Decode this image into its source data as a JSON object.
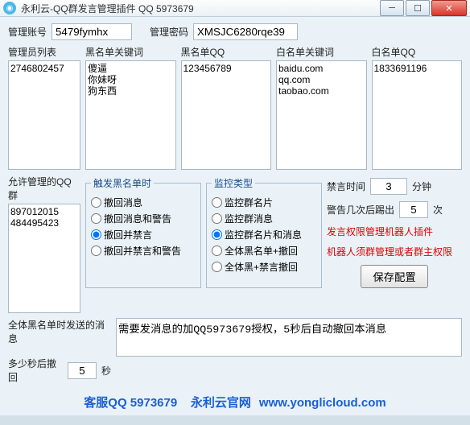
{
  "title": "永利云-QQ群发言管理插件 QQ 5973679",
  "labels": {
    "account": "管理账号",
    "password": "管理密码",
    "adminList": "管理员列表",
    "blackKw": "黑名单关键词",
    "blackQQ": "黑名单QQ",
    "whiteKw": "白名单关键词",
    "whiteQQ": "白名单QQ",
    "allowGroups": "允许管理的QQ群",
    "triggerBlack": "触发黑名单时",
    "monitorType": "监控类型",
    "banTime": "禁言时间",
    "minutes": "分钟",
    "kickAfter": "警告几次后踢出",
    "times": "次",
    "notice1": "发言权限管理机器人插件",
    "notice2": "机器人须群管理或者群主权限",
    "saveBtn": "保存配置",
    "globalMsg": "全体黑名单时发送的消息",
    "recallAfter": "多少秒后撤回",
    "seconds": "秒"
  },
  "values": {
    "account": "5479fymhx",
    "password": "XMSJC6280rqe39",
    "adminList": "2746802457",
    "blackKw": "傻逼\n你妹呀\n狗东西",
    "blackQQ": "123456789",
    "whiteKw": "baidu.com\nqq.com\ntaobao.com",
    "whiteQQ": "1833691196",
    "allowGroups": "897012015\n484495423",
    "banTime": "3",
    "kickAfter": "5",
    "globalMsg": "需要发消息的加QQ5973679授权，5秒后自动撤回本消息",
    "recallAfter": "5"
  },
  "triggerOptions": [
    "撤回消息",
    "撤回消息和警告",
    "撤回并禁言",
    "撤回并禁言和警告"
  ],
  "triggerSelected": 2,
  "monitorOptions": [
    "监控群名片",
    "监控群消息",
    "监控群名片和消息",
    "全体黑名单+撤回",
    "全体黑+禁言撤回"
  ],
  "monitorSelected": 2,
  "footer": {
    "qq": "客服QQ 5973679",
    "site": "永利云官网",
    "url": "www.yonglicloud.com"
  }
}
